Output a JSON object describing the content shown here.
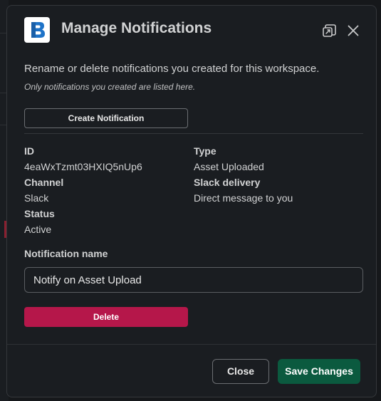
{
  "modal": {
    "title": "Manage Notifications",
    "description": "Rename or delete notifications you created for this workspace.",
    "subdescription": "Only notifications you created are listed here.",
    "create_button": "Create Notification"
  },
  "icons": {
    "logo": "brandfolder-logo-icon",
    "open_external": "open-in-new-window-icon",
    "close": "close-icon"
  },
  "details": {
    "id_label": "ID",
    "id_value": "4eaWxTzmt03HXIQ5nUp6",
    "type_label": "Type",
    "type_value": "Asset Uploaded",
    "channel_label": "Channel",
    "channel_value": "Slack",
    "slack_delivery_label": "Slack delivery",
    "slack_delivery_value": "Direct message to you",
    "status_label": "Status",
    "status_value": "Active"
  },
  "name_field": {
    "label": "Notification name",
    "value": "Notify on Asset Upload"
  },
  "delete_button": "Delete",
  "footer": {
    "close_button": "Close",
    "save_button": "Save Changes"
  },
  "colors": {
    "background": "#1a1d21",
    "delete": "#b5174a",
    "save": "#0b5a3f",
    "logo_blue": "#1e73c8"
  }
}
